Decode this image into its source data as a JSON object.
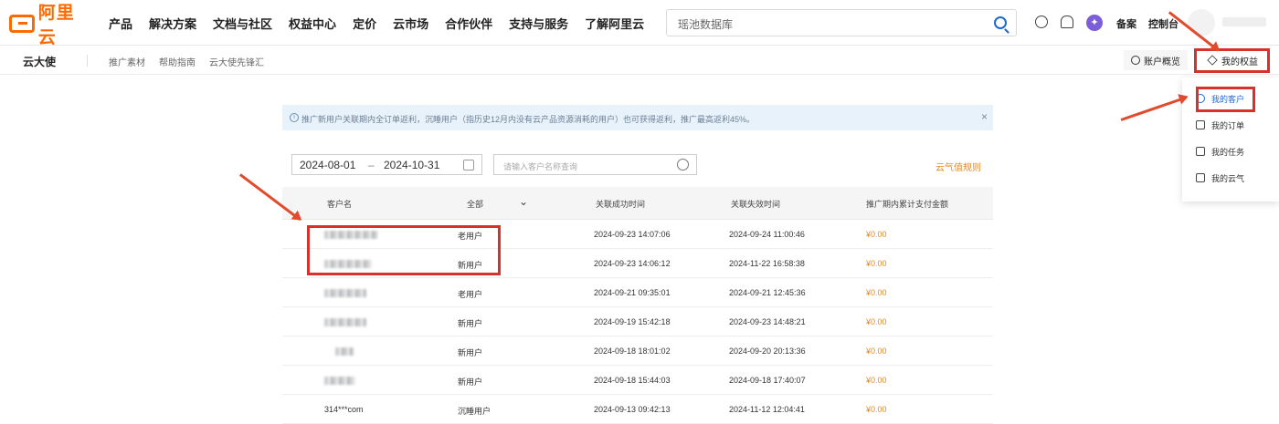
{
  "header": {
    "logo_text": "阿里云",
    "nav": [
      "产品",
      "解决方案",
      "文档与社区",
      "权益中心",
      "定价",
      "云市场",
      "合作伙伴",
      "支持与服务",
      "了解阿里云"
    ],
    "search_placeholder": "瑶池数据库",
    "links": {
      "filing": "备案",
      "console": "控制台"
    }
  },
  "subheader": {
    "brand": "云大使",
    "nav": [
      "推广素材",
      "帮助指南",
      "云大使先锋汇"
    ],
    "account_button": "账户概览",
    "rights_button": "我的权益"
  },
  "dropdown": {
    "items": [
      {
        "label": "我的客户",
        "active": true
      },
      {
        "label": "我的订单",
        "active": false
      },
      {
        "label": "我的任务",
        "active": false
      },
      {
        "label": "我的云气",
        "active": false
      }
    ]
  },
  "notice": {
    "text": "推广新用户关联期内全订单返利，沉睡用户（指历史12月内没有云产品资源消耗的用户）也可获得返利，推广最高返利45%。"
  },
  "filters": {
    "date_start": "2024-08-01",
    "date_end": "2024-10-31",
    "date_separator": "–",
    "customer_placeholder": "请输入客户名称查询",
    "rules_link": "云气值规则"
  },
  "table": {
    "columns": [
      "客户名",
      "全部",
      "关联成功时间",
      "关联失效时间",
      "推广期内累计支付金额"
    ],
    "rows": [
      {
        "name": "",
        "type": "老用户",
        "start": "2024-09-23 14:07:06",
        "end": "2024-09-24 11:00:46",
        "amount": "¥0.00"
      },
      {
        "name": "",
        "type": "新用户",
        "start": "2024-09-23 14:06:12",
        "end": "2024-11-22 16:58:38",
        "amount": "¥0.00"
      },
      {
        "name": "",
        "type": "老用户",
        "start": "2024-09-21 09:35:01",
        "end": "2024-09-21 12:45:36",
        "amount": "¥0.00"
      },
      {
        "name": "",
        "type": "新用户",
        "start": "2024-09-19 15:42:18",
        "end": "2024-09-23 14:48:21",
        "amount": "¥0.00"
      },
      {
        "name": "",
        "type": "新用户",
        "start": "2024-09-18 18:01:02",
        "end": "2024-09-20 20:13:36",
        "amount": "¥0.00"
      },
      {
        "name": "",
        "type": "新用户",
        "start": "2024-09-18 15:44:03",
        "end": "2024-09-18 17:40:07",
        "amount": "¥0.00"
      },
      {
        "name": "314***com",
        "type": "沉睡用户",
        "start": "2024-09-13 09:42:13",
        "end": "2024-11-12 12:04:41",
        "amount": "¥0.00"
      }
    ]
  },
  "colors": {
    "brand": "#ff6a00",
    "link": "#1f67d1",
    "annotation": "#d9302a",
    "amount": "#e08a28"
  }
}
